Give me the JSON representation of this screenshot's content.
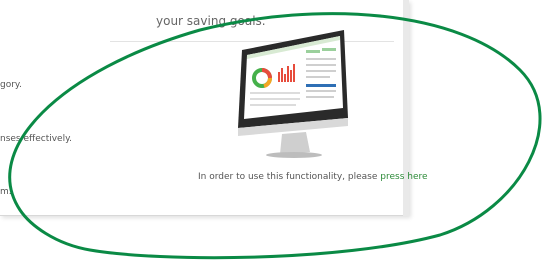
{
  "intro": {
    "heading_fragment": "your saving goals."
  },
  "features": [
    "gory.",
    "nses effectively.",
    "m."
  ],
  "cta": {
    "prefix": "In order to use this functionality, please",
    "link": "press here"
  },
  "colors": {
    "accent_green": "#2e8b3a",
    "ellipse_green": "#0a8a45",
    "text": "#555555"
  },
  "icons": [
    "desktop-monitor-illustration"
  ]
}
